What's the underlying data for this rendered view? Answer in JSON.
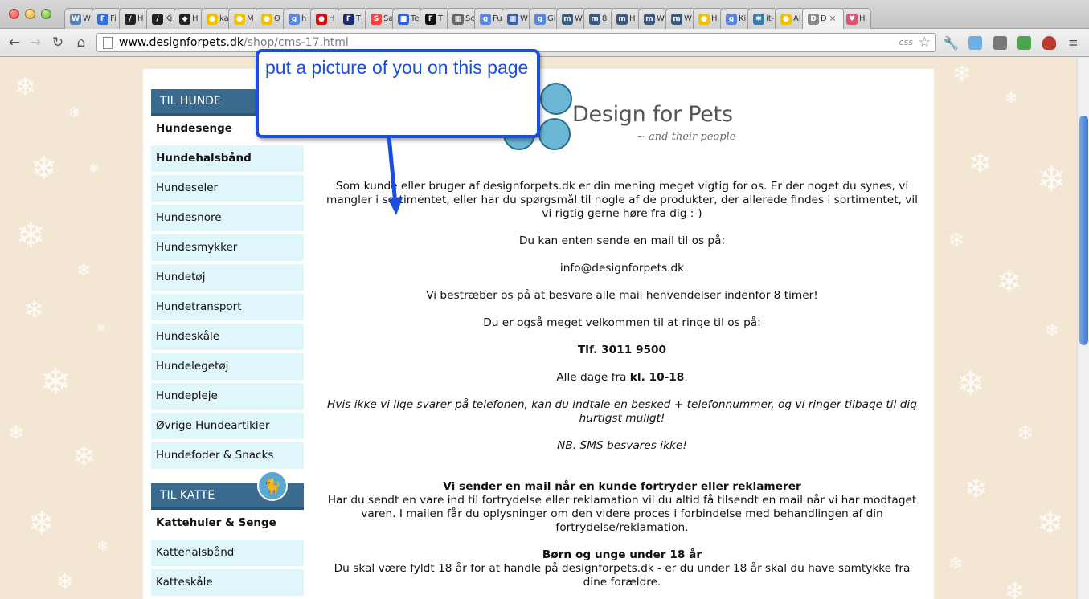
{
  "browser": {
    "tabs": [
      {
        "fav": "W",
        "color": "#5b7fb6",
        "label": "W"
      },
      {
        "fav": "F",
        "color": "#2f6fdd",
        "label": "Fi"
      },
      {
        "fav": "/",
        "color": "#222222",
        "label": "H"
      },
      {
        "fav": "/",
        "color": "#222222",
        "label": "Kj"
      },
      {
        "fav": "◆",
        "color": "#222222",
        "label": "H"
      },
      {
        "fav": "●",
        "color": "#f2c200",
        "label": "ka"
      },
      {
        "fav": "●",
        "color": "#f2c200",
        "label": "M"
      },
      {
        "fav": "●",
        "color": "#f2c200",
        "label": "O"
      },
      {
        "fav": "g",
        "color": "#5a86e0",
        "label": "h"
      },
      {
        "fav": "●",
        "color": "#d01010",
        "label": "H"
      },
      {
        "fav": "F",
        "color": "#1c2c6a",
        "label": "Tl"
      },
      {
        "fav": "S",
        "color": "#e44",
        "label": "Sa"
      },
      {
        "fav": "■",
        "color": "#2864d8",
        "label": "Te"
      },
      {
        "fav": "F",
        "color": "#111111",
        "label": "Tl"
      },
      {
        "fav": "▦",
        "color": "#666666",
        "label": "Sc"
      },
      {
        "fav": "g",
        "color": "#5a86e0",
        "label": "Fu"
      },
      {
        "fav": "▦",
        "color": "#3a5ea8",
        "label": "W"
      },
      {
        "fav": "g",
        "color": "#5a86e0",
        "label": "Gi"
      },
      {
        "fav": "m",
        "color": "#3a5a80",
        "label": "W"
      },
      {
        "fav": "m",
        "color": "#3a5a80",
        "label": "8"
      },
      {
        "fav": "m",
        "color": "#3a5a80",
        "label": "H"
      },
      {
        "fav": "m",
        "color": "#3a5a80",
        "label": "W"
      },
      {
        "fav": "m",
        "color": "#3a5a80",
        "label": "W"
      },
      {
        "fav": "●",
        "color": "#f2c200",
        "label": "H"
      },
      {
        "fav": "g",
        "color": "#5a86e0",
        "label": "Ki"
      },
      {
        "fav": "✱",
        "color": "#3a7aa8",
        "label": "it-"
      },
      {
        "fav": "●",
        "color": "#f2c200",
        "label": "Al"
      },
      {
        "fav": "D",
        "color": "#888888",
        "label": "D",
        "active": true,
        "close": "×"
      },
      {
        "fav": "♥",
        "color": "#e05070",
        "label": "H"
      }
    ],
    "url_domain": "www.designforpets.dk",
    "url_path": "/shop/cms-17.html",
    "css_badge": "css"
  },
  "callout": {
    "text": "put a picture of you on this page"
  },
  "logo": {
    "title": "Design for Pets",
    "subtitle": "~ and their people"
  },
  "sidebar": {
    "dogs_header": "TIL HUNDE",
    "dogs_items": [
      {
        "label": "Hundesenge",
        "bold": true
      },
      {
        "label": "Hundehalsbånd",
        "bold": true
      },
      {
        "label": "Hundeseler",
        "bold": false
      },
      {
        "label": "Hundesnore",
        "bold": false
      },
      {
        "label": "Hundesmykker",
        "bold": false
      },
      {
        "label": "Hundetøj",
        "bold": false
      },
      {
        "label": "Hundetransport",
        "bold": false
      },
      {
        "label": "Hundeskåle",
        "bold": false
      },
      {
        "label": "Hundelegetøj",
        "bold": false
      },
      {
        "label": "Hundepleje",
        "bold": false
      },
      {
        "label": "Øvrige Hundeartikler",
        "bold": false
      },
      {
        "label": "Hundefoder & Snacks",
        "bold": false
      }
    ],
    "cats_header": "TIL KATTE",
    "cats_items": [
      {
        "label": "Kattehuler & Senge",
        "bold": true
      },
      {
        "label": "Kattehalsbånd",
        "bold": false
      },
      {
        "label": "Katteskåle",
        "bold": false
      }
    ]
  },
  "content": {
    "intro": "Som kunde eller bruger af designforpets.dk er din mening meget vigtig for os. Er der noget du synes, vi mangler i sortimentet, eller har du spørgsmål til nogle af de produkter, der allerede findes i sortimentet, vil vi rigtig gerne høre fra dig :-)",
    "mail_intro": "Du kan enten sende en mail til os på:",
    "email": "info@designforpets.dk",
    "response_time": "Vi bestræber os på at besvare alle mail henvendelser indenfor 8 timer!",
    "phone_intro": "Du er også meget velkommen til at ringe til os på:",
    "phone": "Tlf. 3011 9500",
    "hours_prefix": "Alle dage fra ",
    "hours_bold": "kl. 10-18",
    "hours_suffix": ".",
    "voicemail": "Hvis ikke vi lige svarer på telefonen, kan du indtale en besked + telefonnummer, og vi ringer tilbage til dig hurtigst muligt!",
    "sms": "NB. SMS besvares ikke!",
    "returns_heading": "Vi sender en mail når en kunde fortryder eller reklamerer",
    "returns_text": "Har du sendt en vare ind til fortrydelse eller reklamation vil du altid få tilsendt en mail når vi har modtaget varen. I mailen får du oplysninger om den videre proces i forbindelse med behandlingen af din fortrydelse/reklamation.",
    "minors_heading": "Børn og unge under 18 år",
    "minors_text": "Du skal være fyldt 18 år for at handle på designforpets.dk - er du under 18 år skal du have samtykke fra dine forældre."
  },
  "colors": {
    "callout": "#1a4ee0",
    "category_header": "#3a6a8e",
    "menu_item": "#dff6fb",
    "page_bg": "#f3e7d4"
  }
}
